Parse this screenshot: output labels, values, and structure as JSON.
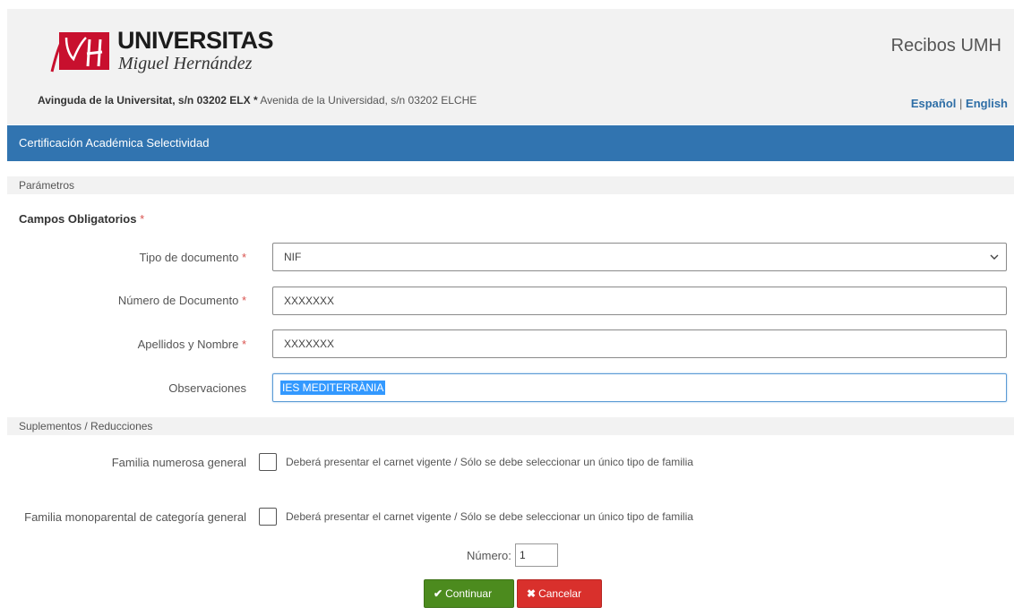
{
  "header": {
    "logo_text": "UNIVERSITAS",
    "logo_subtext": "Miguel Hernández",
    "app_title": "Recibos UMH",
    "address_bold": "Avinguda de la Universitat, s/n 03202 ELX",
    "address_sep": "*",
    "address_rest": "Avenida de la Universidad, s/n 03202 ELCHE",
    "lang_es": "Español",
    "lang_sep": "|",
    "lang_en": "English"
  },
  "nav": {
    "title": "Certificación Académica Selectividad"
  },
  "sections": {
    "params": "Parámetros",
    "required": "Campos Obligatorios",
    "supplements": "Suplementos / Reducciones"
  },
  "asterisk": "*",
  "form": {
    "doc_type": {
      "label": "Tipo de documento",
      "value": "NIF"
    },
    "doc_number": {
      "label": "Número de Documento",
      "value": "XXXXXXX"
    },
    "full_name": {
      "label": "Apellidos y Nombre",
      "value": "XXXXXXX"
    },
    "observations": {
      "label": "Observaciones",
      "value": "IES MEDITERRÀNIA"
    }
  },
  "supplements": {
    "large_family": {
      "label": "Familia numerosa general",
      "note": "Deberá presentar el carnet vigente / Sólo se debe seleccionar un único tipo de familia"
    },
    "single_parent": {
      "label": "Familia monoparental de categoría general",
      "note": "Deberá presentar el carnet vigente / Sólo se debe seleccionar un único tipo de familia"
    },
    "number_label": "Número:",
    "number_value": "1"
  },
  "buttons": {
    "continue": "Continuar",
    "cancel": "Cancelar"
  },
  "colors": {
    "header_bar": "#3174b0",
    "continue": "#4c8b1e",
    "cancel": "#d9302c",
    "required": "#d9534f"
  },
  "icons": {
    "logo": "umh-logo",
    "select_arrow": "chevron-down-icon",
    "continue": "check-icon",
    "cancel": "x-icon"
  }
}
